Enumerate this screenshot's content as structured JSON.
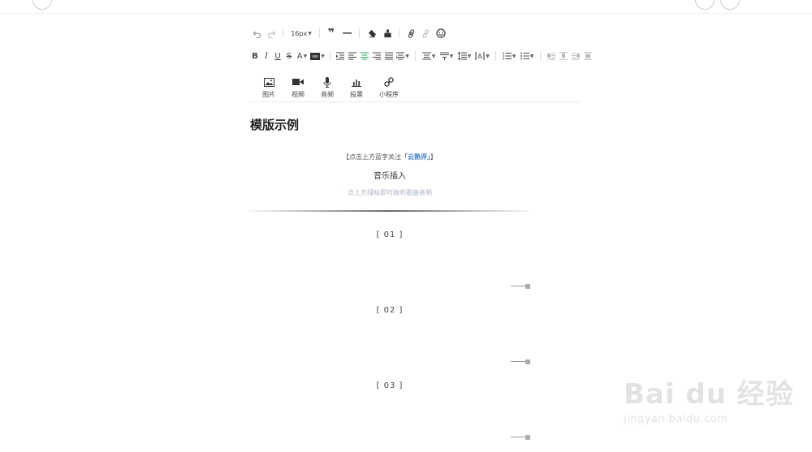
{
  "toolbar": {
    "font_size": "16px"
  },
  "media_bar": {
    "items": [
      {
        "label": "图片"
      },
      {
        "label": "视频"
      },
      {
        "label": "音频"
      },
      {
        "label": "投票"
      },
      {
        "label": "小程序"
      }
    ]
  },
  "document": {
    "title": "模版示例",
    "follow_prefix": "【点击上方蓝字关注",
    "follow_link": "「云熟评」",
    "follow_suffix": "】",
    "music_heading": "音乐插入",
    "music_hint": "点上方绿标即可收听歌曲音频",
    "sections": [
      "[ 01 ]",
      "[ 02 ]",
      "[ 03 ]"
    ]
  },
  "watermark": {
    "brand": "Bai du 经验",
    "url": "jingyan.baidu.com"
  },
  "colors": {
    "link_blue": "#3a7ccf",
    "hint_gray": "#aab4c4",
    "active_green": "#2e9e5a"
  }
}
